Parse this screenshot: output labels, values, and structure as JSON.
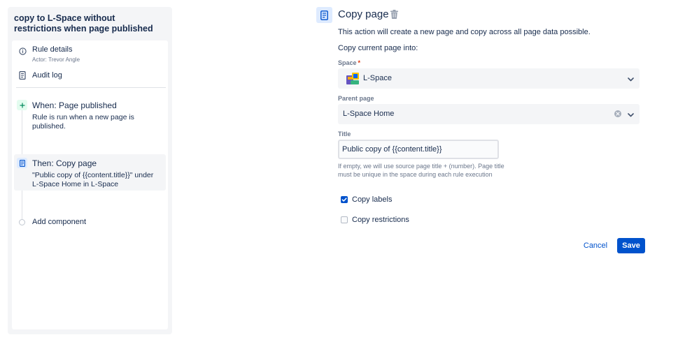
{
  "sidebar": {
    "rule_title": "copy to L-Space without restrictions when page published",
    "rule_details": {
      "label": "Rule details",
      "actor": "Actor: Trevor Angle"
    },
    "audit_log": {
      "label": "Audit log"
    },
    "trigger": {
      "heading": "When: Page published",
      "description": "Rule is run when a new page is published."
    },
    "action": {
      "heading": "Then: Copy page",
      "description": "\"Public copy of {{content.title}}\" under L-Space Home in L-Space"
    },
    "add_component": {
      "label": "Add component"
    }
  },
  "form": {
    "title": "Copy page",
    "description": "This action will create a new page and copy across all page data possible.",
    "copy_into_label": "Copy current page into:",
    "space": {
      "label": "Space",
      "required_marker": "*",
      "value": "L-Space"
    },
    "parent_page": {
      "label": "Parent page",
      "value": "L-Space Home"
    },
    "title_field": {
      "label": "Title",
      "value": "Public copy of {{content.title}}",
      "helper": "If empty, we will use source page title + (number). Page title must be unique in the space during each rule execution"
    },
    "copy_labels": {
      "label": "Copy labels",
      "checked": true
    },
    "copy_restrictions": {
      "label": "Copy restrictions",
      "checked": false
    },
    "buttons": {
      "cancel": "Cancel",
      "save": "Save"
    }
  },
  "colors": {
    "primary": "#0052cc",
    "trigger_badge": "#e3fcef",
    "action_badge": "#deebff",
    "required": "#de350b"
  }
}
